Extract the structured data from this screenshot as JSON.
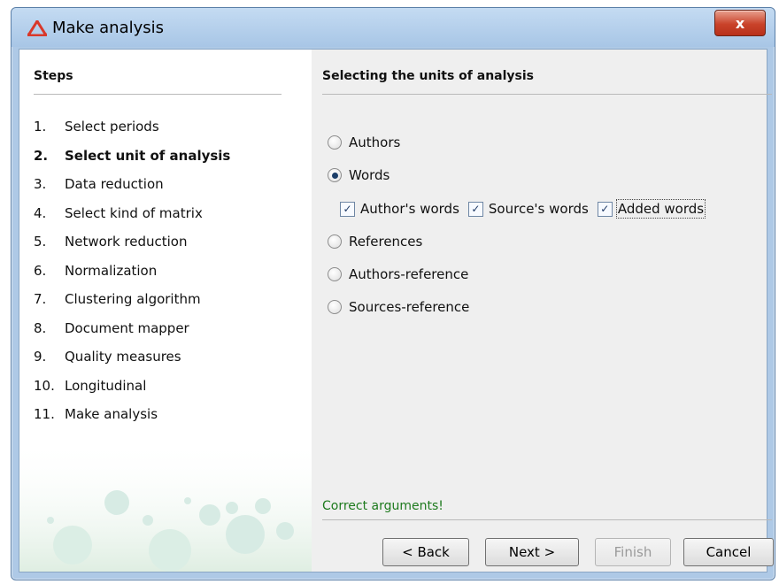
{
  "window": {
    "title": "Make analysis",
    "close_label": "x"
  },
  "steps": {
    "heading": "Steps",
    "items": [
      {
        "num": "1.",
        "label": "Select periods",
        "active": false
      },
      {
        "num": "2.",
        "label": "Select unit of analysis",
        "active": true
      },
      {
        "num": "3.",
        "label": "Data reduction",
        "active": false
      },
      {
        "num": "4.",
        "label": "Select kind of matrix",
        "active": false
      },
      {
        "num": "5.",
        "label": "Network reduction",
        "active": false
      },
      {
        "num": "6.",
        "label": "Normalization",
        "active": false
      },
      {
        "num": "7.",
        "label": "Clustering algorithm",
        "active": false
      },
      {
        "num": "8.",
        "label": "Document mapper",
        "active": false
      },
      {
        "num": "9.",
        "label": "Quality measures",
        "active": false
      },
      {
        "num": "10.",
        "label": "Longitudinal",
        "active": false
      },
      {
        "num": "11.",
        "label": "Make analysis",
        "active": false
      }
    ]
  },
  "content": {
    "heading": "Selecting the units of analysis",
    "options": {
      "authors": "Authors",
      "words": "Words",
      "references": "References",
      "authors_reference": "Authors-reference",
      "sources_reference": "Sources-reference"
    },
    "selected_option": "Words",
    "word_checks": {
      "authors_words": "Author's words",
      "sources_words": "Source's words",
      "added_words": "Added words"
    },
    "status": "Correct arguments!"
  },
  "buttons": {
    "back": "< Back",
    "next": "Next >",
    "finish": "Finish",
    "cancel": "Cancel"
  },
  "colors": {
    "status_text": "#1d7a1d",
    "close_button": "#c9432a"
  }
}
